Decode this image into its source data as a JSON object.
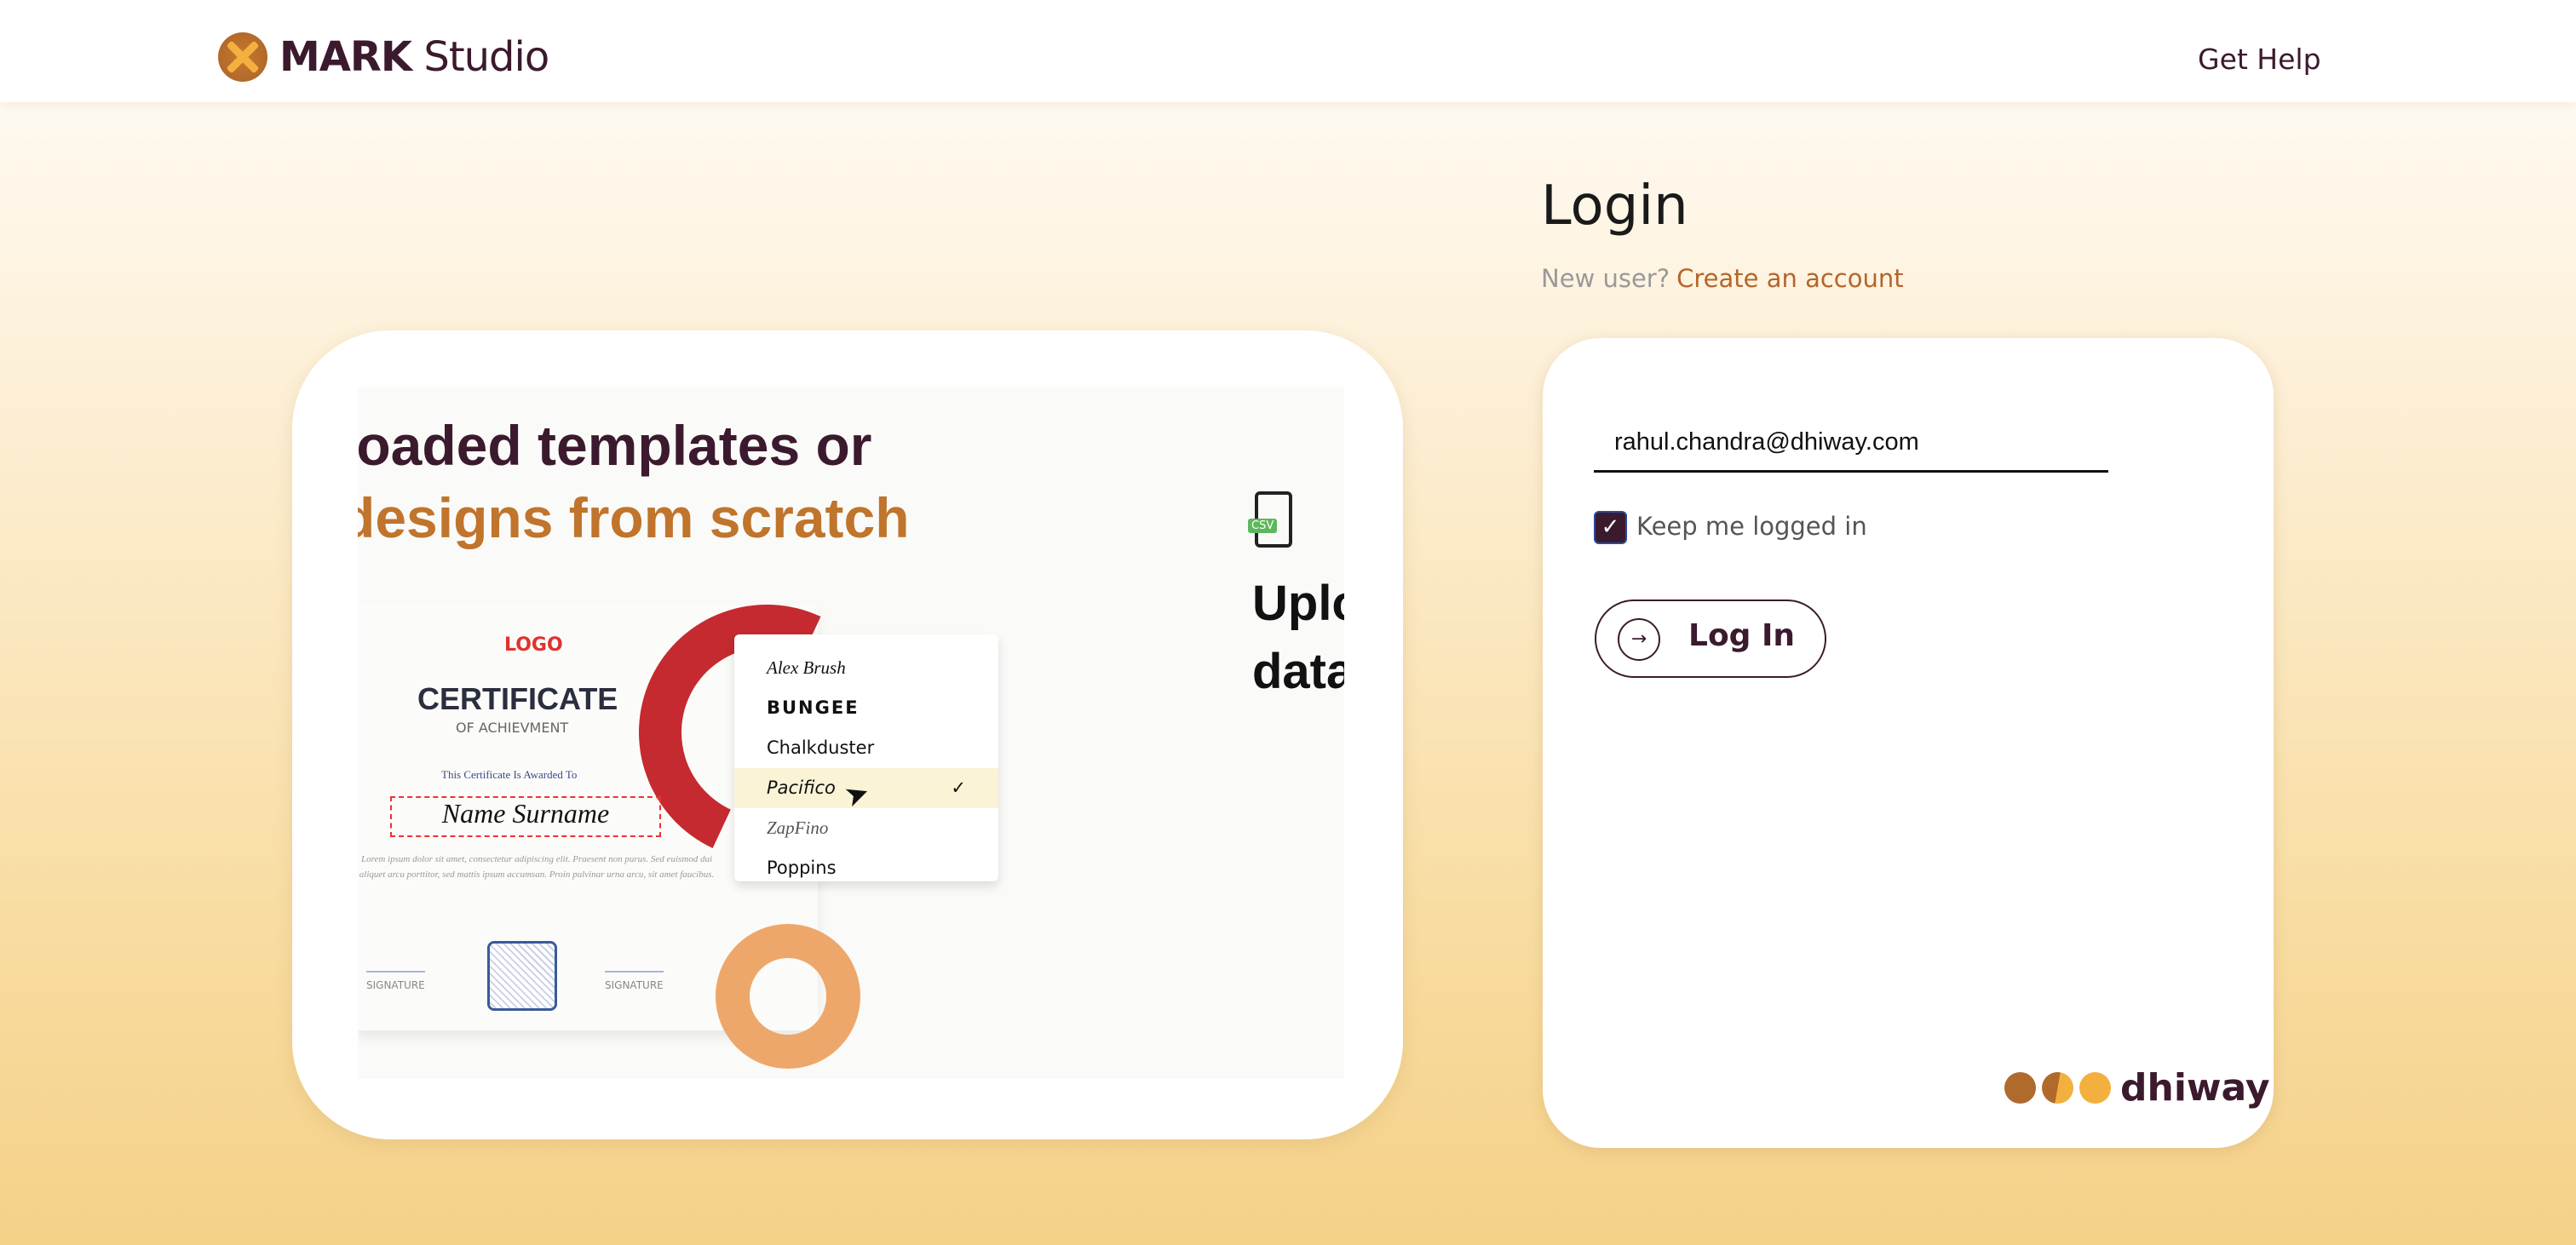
{
  "header": {
    "brand_bold": "MARK",
    "brand_light": "Studio",
    "help": "Get Help"
  },
  "promo": {
    "line1": "loaded templates or",
    "line2": "designs from scratch",
    "certificate_title": "CERTIFICATE",
    "certificate_sub": "OF ACHIEVMENT",
    "logo_text": "LOGO",
    "awarded": "This Certificate Is Awarded To",
    "name": "Name Surname",
    "lorem": "Lorem ipsum dolor sit amet, consectetur adipiscing elit. Praesent non purus. Sed euismod dui aliquet arcu porttitor, sed mattis ipsum accumsan. Proin pulvinar urna arcu, sit amet faucibus.",
    "signature1": "SIGNATURE",
    "signature2": "SIGNATURE",
    "fonts": [
      "Alex Brush",
      "BUNGEE",
      "Chalkduster",
      "Pacifico",
      "ZapFino",
      "Poppins"
    ],
    "selected_font": "Pacifico",
    "csv_label": "CSV",
    "upload1": "Uplo",
    "upload2": "data"
  },
  "login": {
    "title": "Login",
    "new_user": "New user?",
    "create_account": "Create an account",
    "email_value": "rahul.chandra@dhiway.com",
    "keep_logged_in": "Keep me logged in",
    "keep_logged_in_checked": true,
    "login_button": "Log In",
    "footer_logo": "dhiway"
  },
  "colors": {
    "brand": "#3b1a2e",
    "accent": "#b5652a",
    "orange": "#f3b03f"
  }
}
